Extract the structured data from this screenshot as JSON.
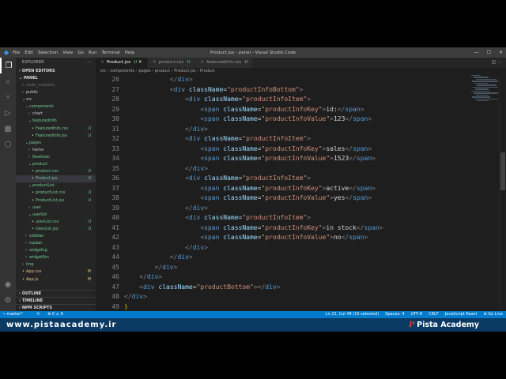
{
  "titlebar": {
    "menu": [
      "File",
      "Edit",
      "Selection",
      "View",
      "Go",
      "Run",
      "Terminal",
      "Help"
    ],
    "window_title": "Product.jsx - panel - Visual Studio Code"
  },
  "sidebar": {
    "header": "EXPLORER",
    "open_editors": "OPEN EDITORS",
    "project": "PANEL",
    "tree": [
      {
        "label": "node_modules",
        "depth": 1,
        "arrow": ">",
        "badge": "",
        "color": "#6b6b6b"
      },
      {
        "label": "public",
        "depth": 1,
        "arrow": ">",
        "badge": "",
        "color": "#cccccc"
      },
      {
        "label": "src",
        "depth": 1,
        "arrow": "v",
        "badge": "",
        "color": "#cccccc"
      },
      {
        "label": "components",
        "depth": 2,
        "arrow": "v",
        "badge": "",
        "color": "#73c991"
      },
      {
        "label": "chart",
        "depth": 3,
        "arrow": ">",
        "badge": "",
        "color": "#cccccc"
      },
      {
        "label": "featuredInfo",
        "depth": 3,
        "arrow": "v",
        "badge": "",
        "color": "#73c991"
      },
      {
        "label": "FeaturedInfo.css",
        "depth": 4,
        "arrow": "",
        "badge": "U",
        "color": "#73c991"
      },
      {
        "label": "FeaturedInfo.jsx",
        "depth": 4,
        "arrow": "",
        "badge": "U",
        "color": "#73c991"
      },
      {
        "label": "pages",
        "depth": 2,
        "arrow": "v",
        "badge": "",
        "color": "#73c991"
      },
      {
        "label": "home",
        "depth": 3,
        "arrow": ">",
        "badge": "",
        "color": "#cccccc"
      },
      {
        "label": "NewUser",
        "depth": 3,
        "arrow": ">",
        "badge": "",
        "color": "#73c991"
      },
      {
        "label": "product",
        "depth": 3,
        "arrow": "v",
        "badge": "",
        "color": "#73c991"
      },
      {
        "label": "product.css",
        "depth": 4,
        "arrow": "",
        "badge": "U",
        "color": "#73c991"
      },
      {
        "label": "Product.jsx",
        "depth": 4,
        "arrow": "",
        "badge": "U",
        "color": "#73c991",
        "selected": true
      },
      {
        "label": "productList",
        "depth": 3,
        "arrow": "v",
        "badge": "",
        "color": "#73c991"
      },
      {
        "label": "productList.css",
        "depth": 4,
        "arrow": "",
        "badge": "U",
        "color": "#73c991"
      },
      {
        "label": "ProductList.jsx",
        "depth": 4,
        "arrow": "",
        "badge": "U",
        "color": "#73c991"
      },
      {
        "label": "user",
        "depth": 3,
        "arrow": ">",
        "badge": "",
        "color": "#73c991"
      },
      {
        "label": "userlist",
        "depth": 3,
        "arrow": "v",
        "badge": "",
        "color": "#73c991"
      },
      {
        "label": "userList.css",
        "depth": 4,
        "arrow": "",
        "badge": "U",
        "color": "#73c991"
      },
      {
        "label": "UserList.jsx",
        "depth": 4,
        "arrow": "",
        "badge": "U",
        "color": "#73c991"
      },
      {
        "label": "sidebar",
        "depth": 2,
        "arrow": ">",
        "badge": "",
        "color": "#73c991"
      },
      {
        "label": "topbar",
        "depth": 2,
        "arrow": ">",
        "badge": "",
        "color": "#73c991"
      },
      {
        "label": "widgetLg",
        "depth": 2,
        "arrow": ">",
        "badge": "",
        "color": "#73c991"
      },
      {
        "label": "widgetSm",
        "depth": 2,
        "arrow": ">",
        "badge": "",
        "color": "#73c991"
      },
      {
        "label": "img",
        "depth": 1,
        "arrow": ">",
        "badge": "",
        "color": "#73c991"
      },
      {
        "label": "App.css",
        "depth": 1,
        "arrow": "",
        "badge": "M",
        "color": "#e2c08d"
      },
      {
        "label": "App.js",
        "depth": 1,
        "arrow": "",
        "badge": "M",
        "color": "#e2c08d"
      }
    ],
    "outline": "OUTLINE",
    "timeline": "TIMELINE",
    "npm_scripts": "NPM SCRIPTS"
  },
  "tabs": [
    {
      "label": "Product.jsx",
      "suffix": "U",
      "active": true
    },
    {
      "label": "product.css",
      "suffix": "U",
      "active": false
    },
    {
      "label": "featuredInfo.css",
      "suffix": "U",
      "active": false
    }
  ],
  "breadcrumb": "src › components › pages › product › Product.jsx › Product",
  "editor": {
    "first_line": 26,
    "lines": [
      [
        [
          "ind",
          "            "
        ],
        [
          "tg",
          "</"
        ],
        [
          "tn",
          "div"
        ],
        [
          "tg",
          ">"
        ]
      ],
      [
        [
          "ind",
          "            "
        ],
        [
          "tg",
          "<"
        ],
        [
          "tn",
          "div"
        ],
        [
          "tx",
          " "
        ],
        [
          "at",
          "className"
        ],
        [
          "tx",
          "="
        ],
        [
          "st",
          "\"productInfoBottom\""
        ],
        [
          "tg",
          ">"
        ]
      ],
      [
        [
          "ind",
          "                "
        ],
        [
          "tg",
          "<"
        ],
        [
          "tn",
          "div"
        ],
        [
          "tx",
          " "
        ],
        [
          "at",
          "className"
        ],
        [
          "tx",
          "="
        ],
        [
          "st",
          "\"productInfoItem\""
        ],
        [
          "tg",
          ">"
        ]
      ],
      [
        [
          "ind",
          "                    "
        ],
        [
          "tg",
          "<"
        ],
        [
          "tn",
          "span"
        ],
        [
          "tx",
          " "
        ],
        [
          "at",
          "className"
        ],
        [
          "tx",
          "="
        ],
        [
          "st",
          "\"productInfoKey\""
        ],
        [
          "tg",
          ">"
        ],
        [
          "tx",
          "id:"
        ],
        [
          "tg",
          "</"
        ],
        [
          "tn",
          "span"
        ],
        [
          "tg",
          ">"
        ]
      ],
      [
        [
          "ind",
          "                    "
        ],
        [
          "tg",
          "<"
        ],
        [
          "tn",
          "span"
        ],
        [
          "tx",
          " "
        ],
        [
          "at",
          "className"
        ],
        [
          "tx",
          "="
        ],
        [
          "st",
          "\"productInfoValue\""
        ],
        [
          "tg",
          ">"
        ],
        [
          "tx",
          "123"
        ],
        [
          "tg",
          "</"
        ],
        [
          "tn",
          "span"
        ],
        [
          "tg",
          ">"
        ]
      ],
      [
        [
          "ind",
          "                "
        ],
        [
          "tg",
          "</"
        ],
        [
          "tn",
          "div"
        ],
        [
          "tg",
          ">"
        ]
      ],
      [
        [
          "ind",
          "                "
        ],
        [
          "tg",
          "<"
        ],
        [
          "tn",
          "div"
        ],
        [
          "tx",
          " "
        ],
        [
          "at",
          "className"
        ],
        [
          "tx",
          "="
        ],
        [
          "st",
          "\"productInfoItem\""
        ],
        [
          "tg",
          ">"
        ]
      ],
      [
        [
          "ind",
          "                    "
        ],
        [
          "tg",
          "<"
        ],
        [
          "tn",
          "span"
        ],
        [
          "tx",
          " "
        ],
        [
          "at",
          "className"
        ],
        [
          "tx",
          "="
        ],
        [
          "st",
          "\"productInfoKey\""
        ],
        [
          "tg",
          ">"
        ],
        [
          "tx",
          "sales"
        ],
        [
          "tg",
          "</"
        ],
        [
          "tn",
          "span"
        ],
        [
          "tg",
          ">"
        ]
      ],
      [
        [
          "ind",
          "                    "
        ],
        [
          "tg",
          "<"
        ],
        [
          "tn",
          "span"
        ],
        [
          "tx",
          " "
        ],
        [
          "at",
          "className"
        ],
        [
          "tx",
          "="
        ],
        [
          "st",
          "\"productInfoValue\""
        ],
        [
          "tg",
          ">"
        ],
        [
          "tx",
          "1523"
        ],
        [
          "tg",
          "</"
        ],
        [
          "tn",
          "span"
        ],
        [
          "tg",
          ">"
        ]
      ],
      [
        [
          "ind",
          "                "
        ],
        [
          "tg",
          "</"
        ],
        [
          "tn",
          "div"
        ],
        [
          "tg",
          ">"
        ]
      ],
      [
        [
          "ind",
          "                "
        ],
        [
          "tg",
          "<"
        ],
        [
          "tn",
          "div"
        ],
        [
          "tx",
          " "
        ],
        [
          "at",
          "className"
        ],
        [
          "tx",
          "="
        ],
        [
          "st",
          "\"productInfoItem\""
        ],
        [
          "tg",
          ">"
        ]
      ],
      [
        [
          "ind",
          "                    "
        ],
        [
          "tg",
          "<"
        ],
        [
          "tn",
          "span"
        ],
        [
          "tx",
          " "
        ],
        [
          "at",
          "className"
        ],
        [
          "tx",
          "="
        ],
        [
          "st",
          "\"productInfoKey\""
        ],
        [
          "tg",
          ">"
        ],
        [
          "tx",
          "active"
        ],
        [
          "tg",
          "</"
        ],
        [
          "tn",
          "span"
        ],
        [
          "tg",
          ">"
        ]
      ],
      [
        [
          "ind",
          "                    "
        ],
        [
          "tg",
          "<"
        ],
        [
          "tn",
          "span"
        ],
        [
          "tx",
          " "
        ],
        [
          "at",
          "className"
        ],
        [
          "tx",
          "="
        ],
        [
          "st",
          "\"productInfoValue\""
        ],
        [
          "tg",
          ">"
        ],
        [
          "tx",
          "yes"
        ],
        [
          "tg",
          "</"
        ],
        [
          "tn",
          "span"
        ],
        [
          "tg",
          ">"
        ]
      ],
      [
        [
          "ind",
          "                "
        ],
        [
          "tg",
          "</"
        ],
        [
          "tn",
          "div"
        ],
        [
          "tg",
          ">"
        ]
      ],
      [
        [
          "ind",
          "                "
        ],
        [
          "tg",
          "<"
        ],
        [
          "tn",
          "div"
        ],
        [
          "tx",
          " "
        ],
        [
          "at",
          "className"
        ],
        [
          "tx",
          "="
        ],
        [
          "st",
          "\"productInfoItem\""
        ],
        [
          "tg",
          ">"
        ]
      ],
      [
        [
          "ind",
          "                    "
        ],
        [
          "tg",
          "<"
        ],
        [
          "tn",
          "span"
        ],
        [
          "tx",
          " "
        ],
        [
          "at",
          "className"
        ],
        [
          "tx",
          "="
        ],
        [
          "st",
          "\"productInfoKey\""
        ],
        [
          "tg",
          ">"
        ],
        [
          "tx",
          "in stock"
        ],
        [
          "tg",
          "</"
        ],
        [
          "tn",
          "span"
        ],
        [
          "tg",
          ">"
        ]
      ],
      [
        [
          "ind",
          "                    "
        ],
        [
          "tg",
          "<"
        ],
        [
          "tn",
          "span"
        ],
        [
          "tx",
          " "
        ],
        [
          "at",
          "className"
        ],
        [
          "tx",
          "="
        ],
        [
          "st",
          "\"productInfoValue\""
        ],
        [
          "tg",
          ">"
        ],
        [
          "tx",
          "no"
        ],
        [
          "tg",
          "</"
        ],
        [
          "tn",
          "span"
        ],
        [
          "tg",
          ">"
        ]
      ],
      [
        [
          "ind",
          "                "
        ],
        [
          "tg",
          "</"
        ],
        [
          "tn",
          "div"
        ],
        [
          "tg",
          ">"
        ]
      ],
      [
        [
          "ind",
          "            "
        ],
        [
          "tg",
          "</"
        ],
        [
          "tn",
          "div"
        ],
        [
          "tg",
          ">"
        ]
      ],
      [
        [
          "ind",
          "        "
        ],
        [
          "tg",
          "</"
        ],
        [
          "tn",
          "div"
        ],
        [
          "tg",
          ">"
        ]
      ],
      [
        [
          "ind",
          "    "
        ],
        [
          "tg",
          "</"
        ],
        [
          "tn",
          "div"
        ],
        [
          "tg",
          ">"
        ]
      ],
      [
        [
          "ind",
          "    "
        ],
        [
          "tg",
          "<"
        ],
        [
          "tn",
          "div"
        ],
        [
          "tx",
          " "
        ],
        [
          "at",
          "className"
        ],
        [
          "tx",
          "="
        ],
        [
          "st",
          "\"productBottom\""
        ],
        [
          "tg",
          "></"
        ],
        [
          "tn",
          "div"
        ],
        [
          "tg",
          ">"
        ]
      ],
      [
        [
          "ind",
          ""
        ],
        [
          "tg",
          "</"
        ],
        [
          "tn",
          "div"
        ],
        [
          "tg",
          ">"
        ]
      ],
      [
        [
          "br",
          ")"
        ]
      ]
    ]
  },
  "status": {
    "branch": "master*",
    "sync": "⟳",
    "problems": "⊗ 0 ⚠ 6",
    "right": [
      "Ln 22, Col 48 (15 selected)",
      "Spaces: 4",
      "UTF-8",
      "CRLF",
      "JavaScript React",
      "⊕ Go Live"
    ]
  },
  "watermark": {
    "url": "www.pistaacademy.ir",
    "brand": "Pista Academy"
  }
}
